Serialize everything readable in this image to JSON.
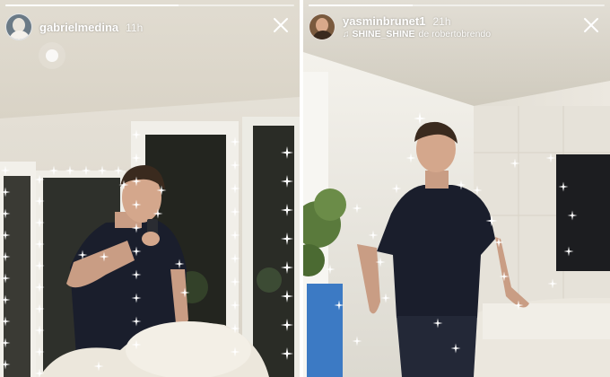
{
  "stories": [
    {
      "username": "gabrielmedina",
      "time": "11h",
      "close_icon": "close-icon",
      "avatar_icon": "avatar-image"
    },
    {
      "username": "yasminbrunet1",
      "time": "21h",
      "music": {
        "icon": "music-note-icon",
        "title": "SHINE_SHINE",
        "by": "de robertobrendo"
      },
      "close_icon": "close-icon",
      "avatar_icon": "avatar-image"
    }
  ],
  "colors": {
    "sparkle": "#ffffff",
    "text": "#ffffff",
    "shirt": "#1a1e2c"
  }
}
